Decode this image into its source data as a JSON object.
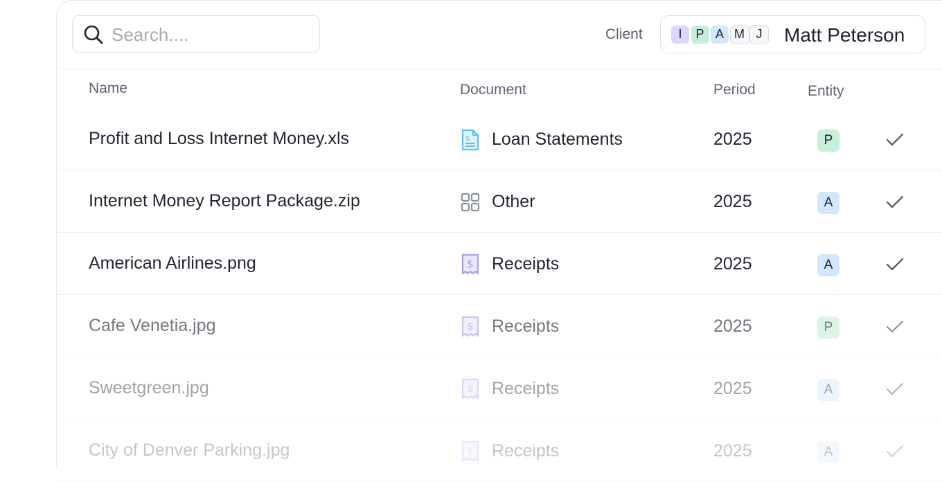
{
  "search": {
    "placeholder": "Search....",
    "icon": "search-icon"
  },
  "client": {
    "label": "Client",
    "selected_name": "Matt Peterson",
    "avatars": [
      {
        "initial": "I",
        "color": "#ddd6fe"
      },
      {
        "initial": "P",
        "color": "#c7eed8"
      },
      {
        "initial": "A",
        "color": "#d3e6fb"
      },
      {
        "initial": "M",
        "color": "#f6f7f9"
      },
      {
        "initial": "J",
        "color": "#f6f7f9"
      }
    ]
  },
  "table": {
    "columns": [
      "Name",
      "Document",
      "Period",
      "Entity"
    ],
    "rows": [
      {
        "name": "Profit and Loss Internet Money.xls",
        "document": "Loan Statements",
        "doc_icon": "statement-icon",
        "period": "2025",
        "entity": "P",
        "entity_color": "#c7eed8",
        "checked": true
      },
      {
        "name": "Internet Money Report Package.zip",
        "document": "Other",
        "doc_icon": "grid-icon",
        "period": "2025",
        "entity": "A",
        "entity_color": "#d3e6fb",
        "checked": true
      },
      {
        "name": "American Airlines.png",
        "document": "Receipts",
        "doc_icon": "receipt-icon",
        "period": "2025",
        "entity": "A",
        "entity_color": "#d3e6fb",
        "checked": true
      },
      {
        "name": "Cafe Venetia.jpg",
        "document": "Receipts",
        "doc_icon": "receipt-icon",
        "period": "2025",
        "entity": "P",
        "entity_color": "#c7eed8",
        "checked": true
      },
      {
        "name": "Sweetgreen.jpg",
        "document": "Receipts",
        "doc_icon": "receipt-icon",
        "period": "2025",
        "entity": "A",
        "entity_color": "#d3e6fb",
        "checked": true
      },
      {
        "name": "City of Denver Parking.jpg",
        "document": "Receipts",
        "doc_icon": "receipt-icon",
        "period": "2025",
        "entity": "A",
        "entity_color": "#d3e6fb",
        "checked": true
      }
    ]
  },
  "colors": {
    "statement_icon": "#5cc3ee",
    "grid_icon": "#8a909b",
    "receipt_icon": "#a9a3e6",
    "check": "#4b5260"
  }
}
